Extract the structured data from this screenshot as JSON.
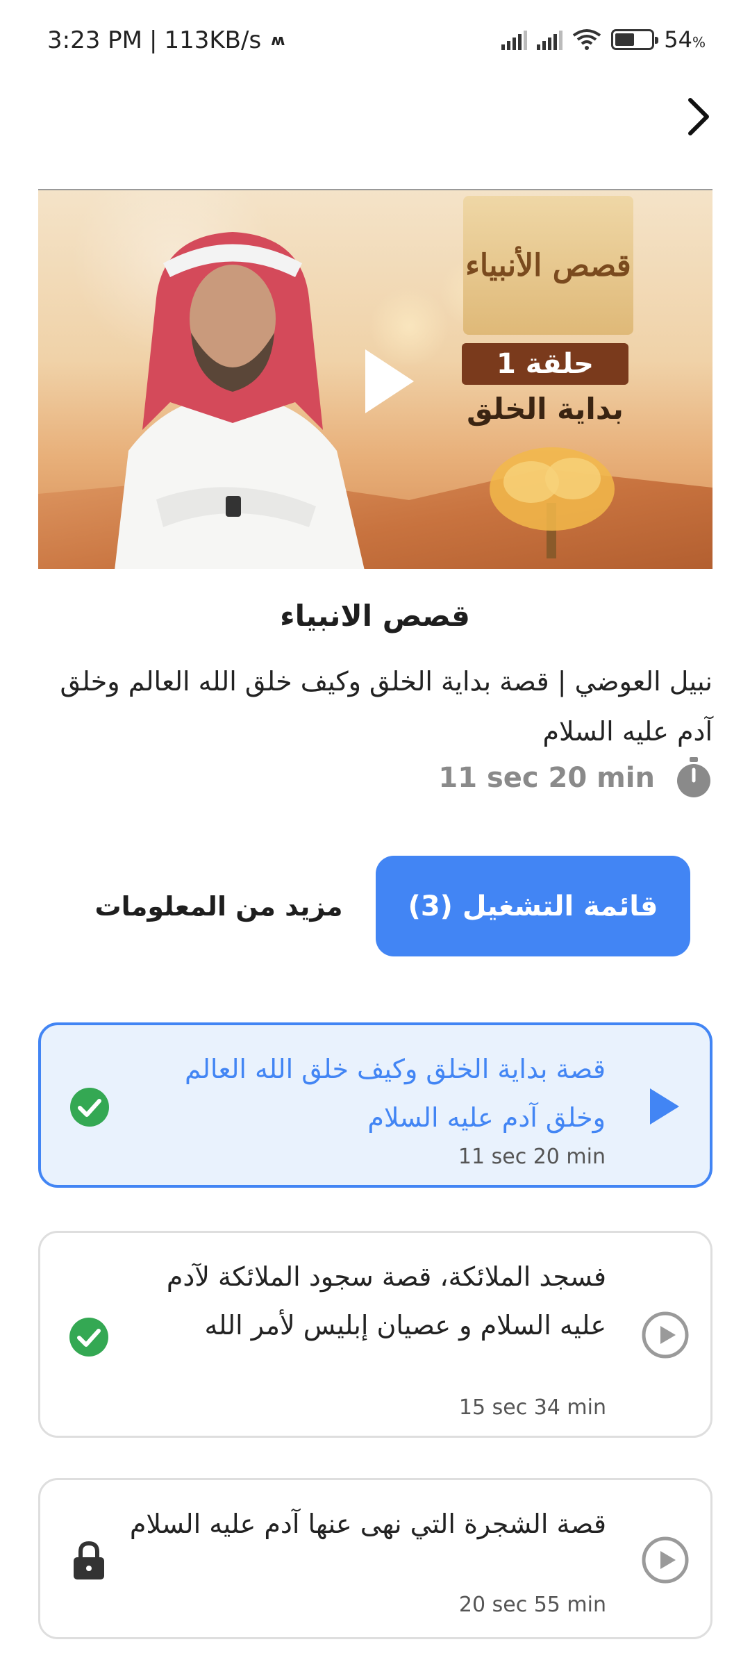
{
  "status_bar": {
    "time": "3:23 PM",
    "separator": "|",
    "speed": "113KB/s",
    "battery": "54",
    "battery_unit": "%"
  },
  "video": {
    "series_logo_text": "قصص الأنبياء",
    "episode_badge": "حلقة 1",
    "episode_title": "بداية الخلق"
  },
  "content": {
    "title": "قصص الانبياء",
    "description": "نبيل العوضي | قصة بداية الخلق وكيف خلق الله العالم وخلق آدم عليه السلام",
    "duration": "11 sec 20 min"
  },
  "buttons": {
    "playlist": "قائمة التشغيل (3)",
    "more_info": "مزيد من المعلومات"
  },
  "episodes": [
    {
      "title": "قصة بداية الخلق وكيف خلق الله العالم وخلق آدم عليه السلام",
      "duration": "11 sec 20 min",
      "status": "completed",
      "active": true
    },
    {
      "title": "فسجد الملائكة، قصة سجود الملائكة لآدم عليه السلام و عصيان إبليس لأمر الله",
      "duration": "15 sec 34 min",
      "status": "completed",
      "active": false
    },
    {
      "title": "قصة الشجرة التي نهى عنها آدم عليه السلام",
      "duration": "20 sec 55 min",
      "status": "locked",
      "active": false
    }
  ],
  "colors": {
    "accent": "#4285f4",
    "active_bg": "#e9f2fd",
    "success": "#34a853",
    "muted": "#8a8a8a"
  },
  "icons": {
    "back": "chevron-right-icon",
    "play": "play-icon",
    "timer": "stopwatch-icon",
    "done": "check-circle-icon",
    "locked": "lock-icon"
  }
}
